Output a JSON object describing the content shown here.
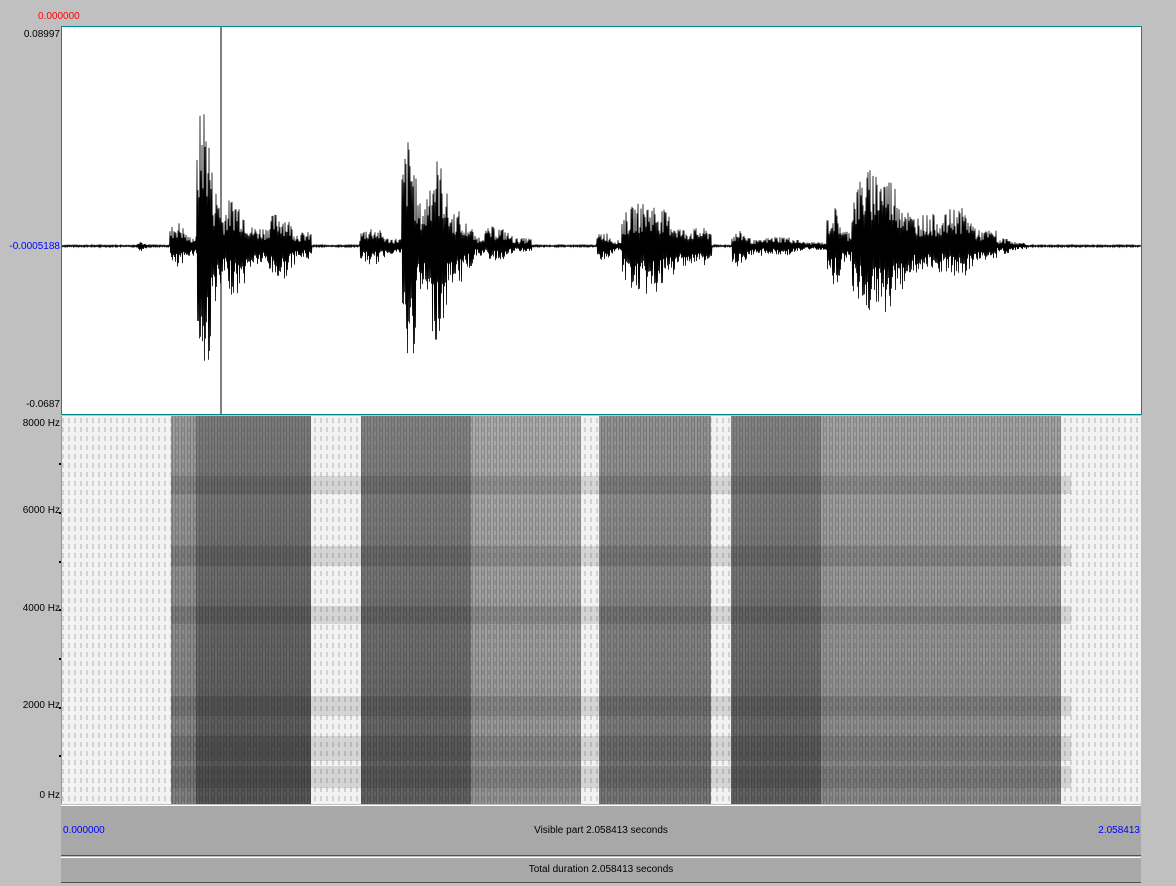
{
  "cursor": {
    "time": "0.000000"
  },
  "waveform": {
    "y_max_label": "0.08997",
    "y_mid_label": "-0.0005188",
    "y_min_label": "-0.0687"
  },
  "spectrogram": {
    "y_labels": [
      "8000 Hz",
      "6000 Hz",
      "4000 Hz",
      "2000 Hz",
      "0 Hz"
    ]
  },
  "time_bar": {
    "start": "0.000000",
    "visible_part": "Visible part 2.058413 seconds",
    "end": "2.058413",
    "total_duration": "Total duration 2.058413 seconds"
  },
  "colors": {
    "cursor": "#ff0000",
    "axis_value": "#0000ff",
    "waveform_border": "#008b8b",
    "bar_background": "#a8a8a8"
  }
}
